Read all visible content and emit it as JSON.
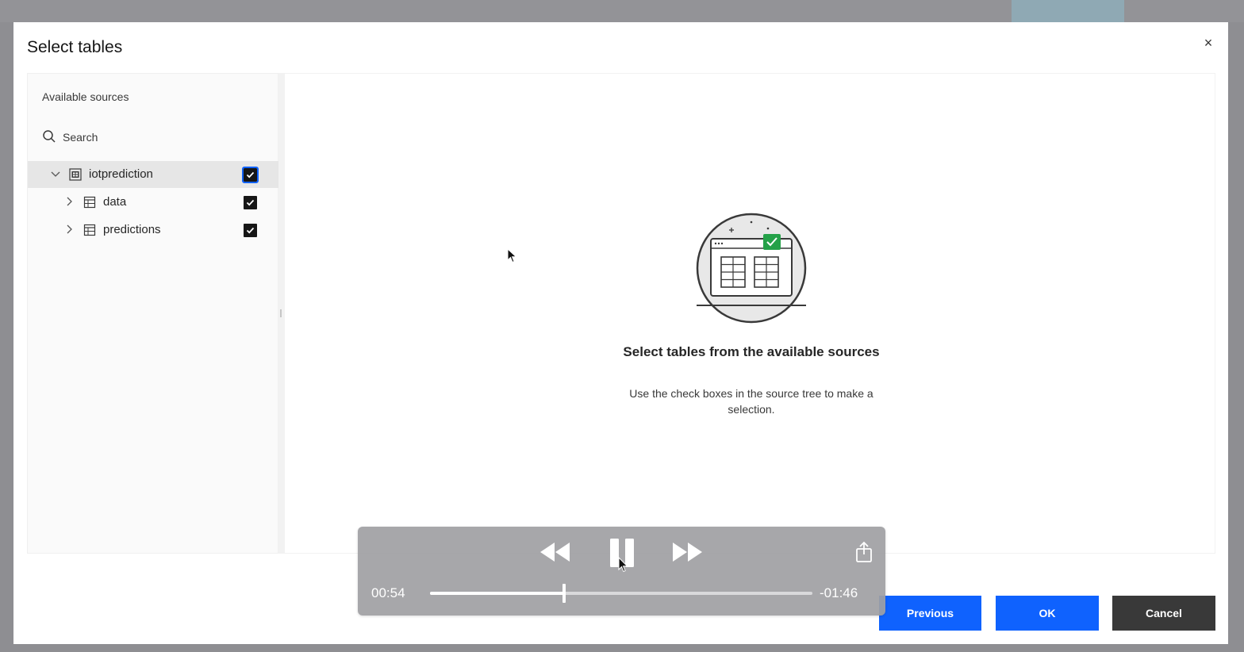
{
  "dialog": {
    "title": "Select tables",
    "close_glyph": "×"
  },
  "sources": {
    "title": "Available sources",
    "search_placeholder": "Search",
    "tree": [
      {
        "label": "iotprediction",
        "icon": "schema-icon",
        "expanded": true,
        "checked": true,
        "selected": true
      },
      {
        "label": "data",
        "icon": "table-icon",
        "expanded": false,
        "checked": true
      },
      {
        "label": "predictions",
        "icon": "table-icon",
        "expanded": false,
        "checked": true
      }
    ]
  },
  "empty_state": {
    "title": "Select tables from the available sources",
    "subtitle": "Use the check boxes in the source tree to make a selection."
  },
  "footer": {
    "previous_label": "Previous",
    "ok_label": "OK",
    "cancel_label": "Cancel"
  },
  "player": {
    "elapsed": "00:54",
    "remaining": "-01:46",
    "progress_fraction": 0.35
  },
  "colors": {
    "primary": "#0f62fe",
    "secondary": "#393939",
    "checkbox": "#161616"
  }
}
